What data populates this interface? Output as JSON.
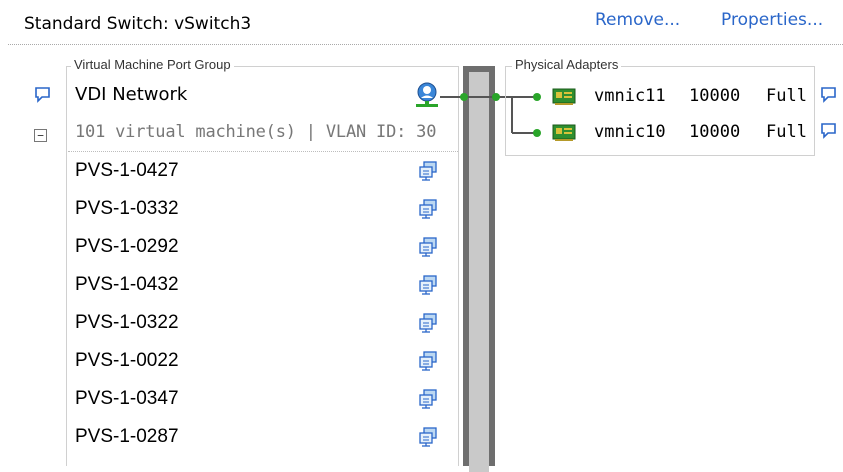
{
  "header": {
    "title": "Standard Switch: vSwitch3",
    "remove_label": "Remove...",
    "properties_label": "Properties..."
  },
  "port_group": {
    "legend": "Virtual Machine Port Group",
    "name": "VDI Network",
    "summary": "101 virtual machine(s) | VLAN ID: 30",
    "collapse_symbol": "−",
    "vms": [
      {
        "name": "PVS-1-0427"
      },
      {
        "name": "PVS-1-0332"
      },
      {
        "name": "PVS-1-0292"
      },
      {
        "name": "PVS-1-0432"
      },
      {
        "name": "PVS-1-0322"
      },
      {
        "name": "PVS-1-0022"
      },
      {
        "name": "PVS-1-0347"
      },
      {
        "name": "PVS-1-0287"
      }
    ]
  },
  "physical_adapters": {
    "legend": "Physical Adapters",
    "adapters": [
      {
        "name": "vmnic11",
        "speed": "10000",
        "duplex": "Full"
      },
      {
        "name": "vmnic10",
        "speed": "10000",
        "duplex": "Full"
      }
    ]
  },
  "colors": {
    "link": "#2a66c9",
    "connector_green": "#2aa52a",
    "switch_bar": "#6e6e6e"
  },
  "icons": {
    "tooltip": "speech-bubble-icon",
    "vm": "virtual-machine-icon",
    "network": "network-globe-icon",
    "nic": "network-card-icon"
  }
}
